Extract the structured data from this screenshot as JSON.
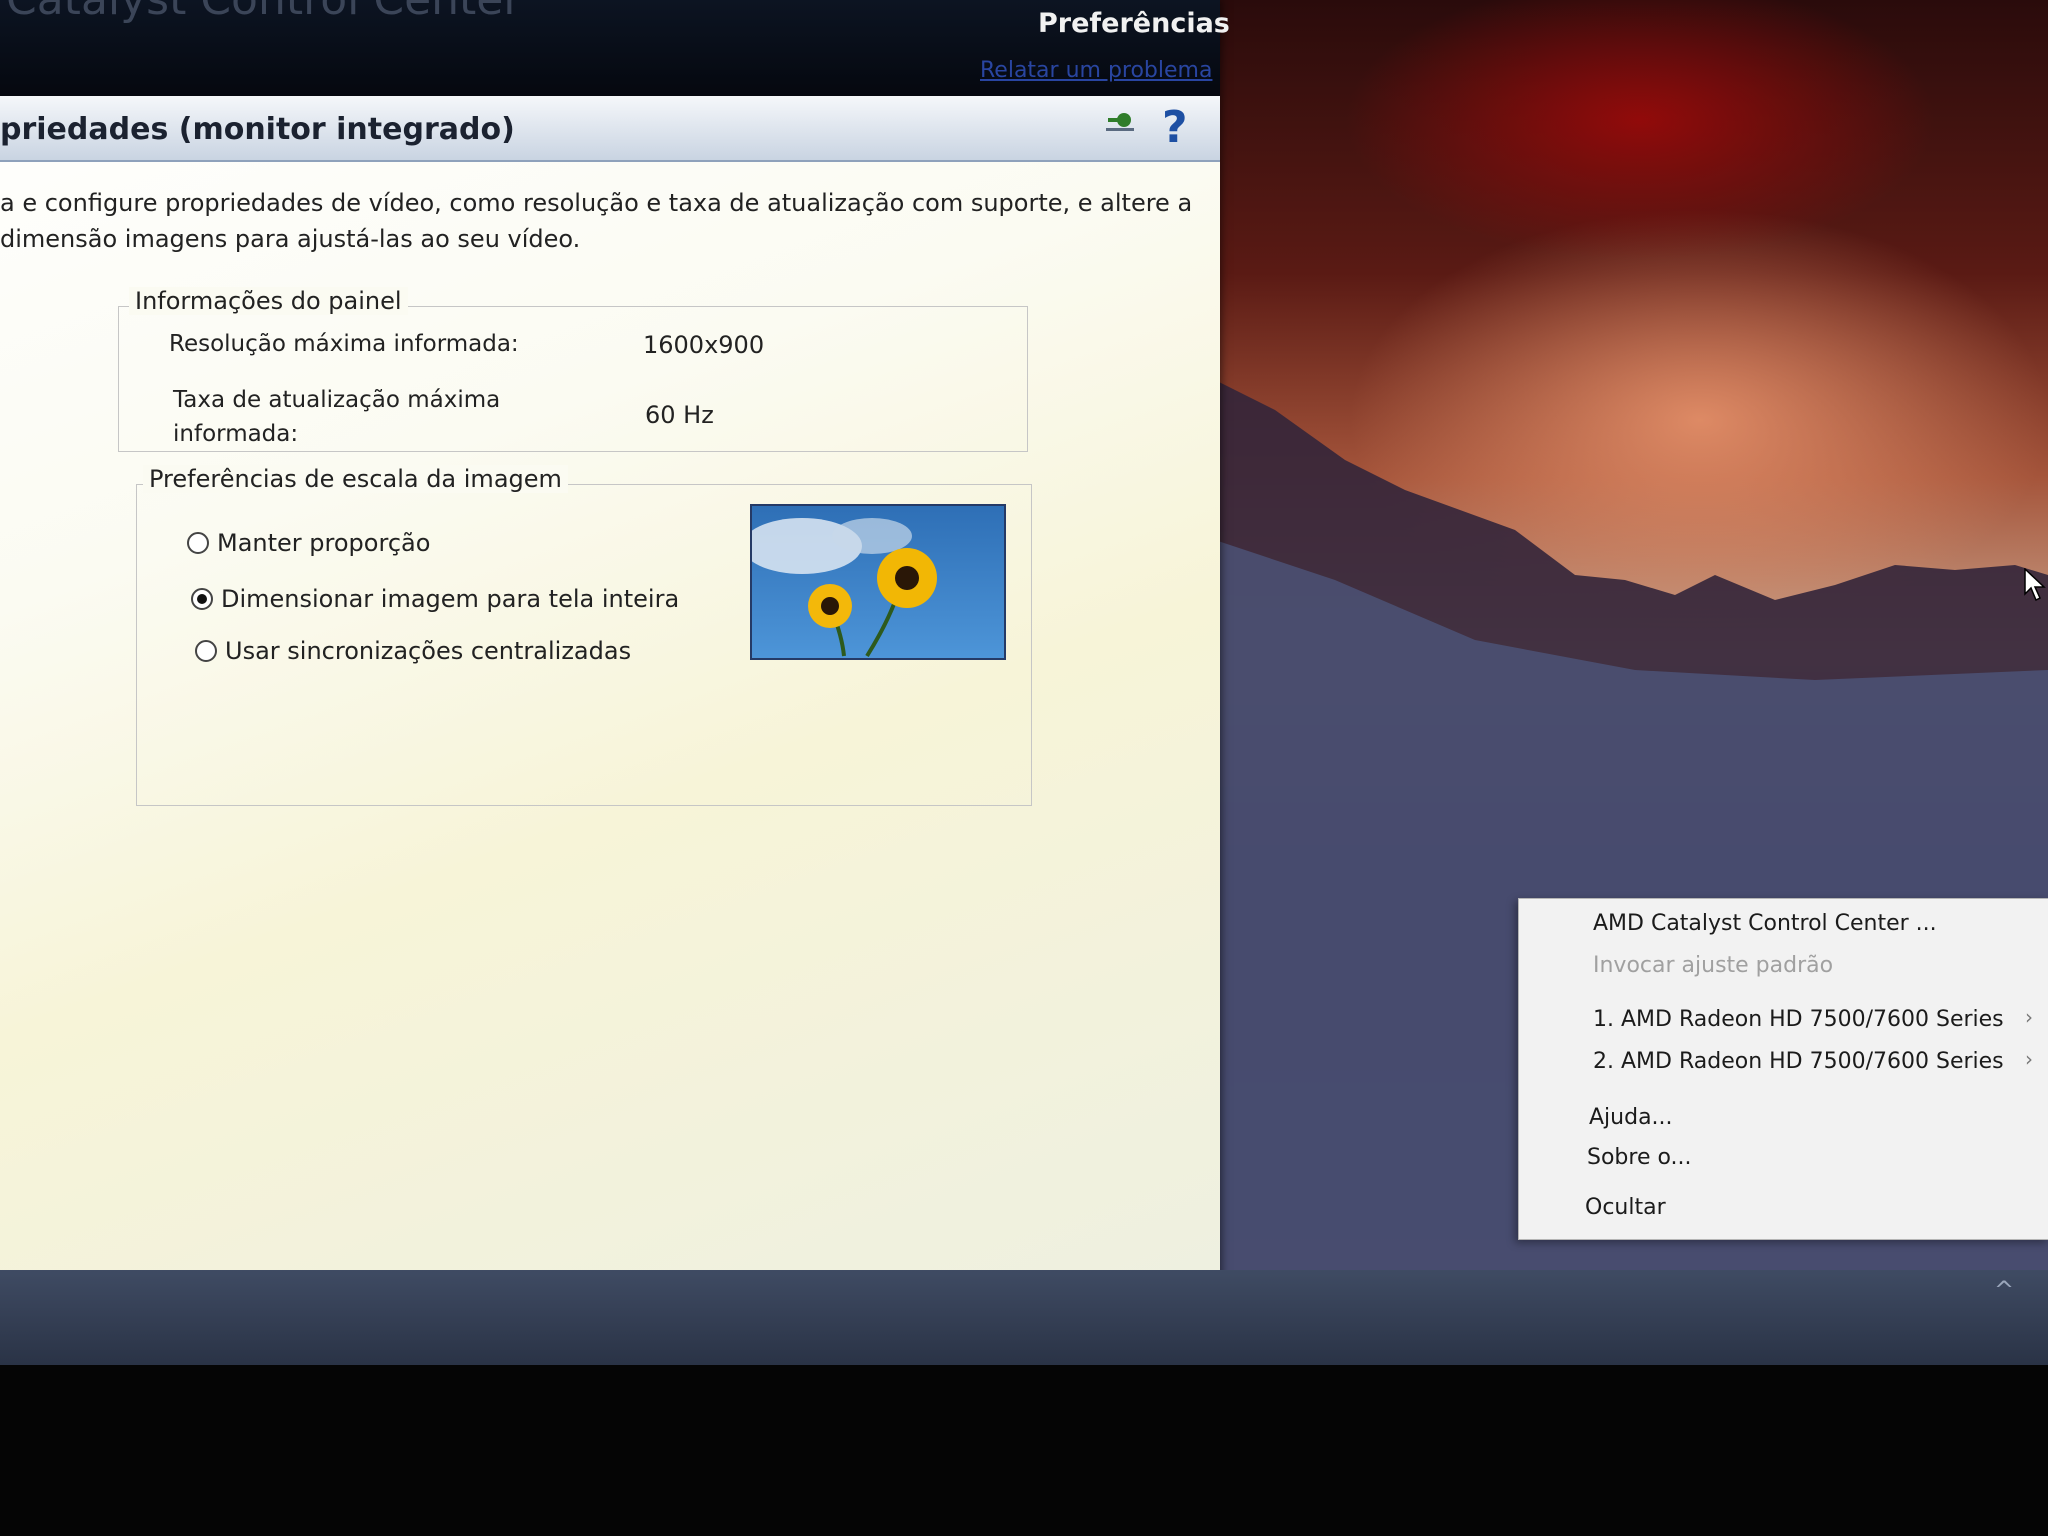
{
  "window": {
    "app_title": "Catalyst Control Center",
    "preferences_menu": "Preferências",
    "report_problem_link": "Relatar um problema"
  },
  "page": {
    "title": "priedades (monitor integrado)",
    "description": "a e configure propriedades de vídeo, como resolução e taxa de atualização com suporte, e altere a dimensão imagens para ajustá-las ao seu vídeo."
  },
  "panel_info": {
    "legend": "Informações do painel",
    "max_resolution_label": "Resolução máxima informada:",
    "max_resolution_value": "1600x900",
    "max_refresh_label": "Taxa de atualização máxima informada:",
    "max_refresh_value": "60 Hz"
  },
  "scaling": {
    "legend": "Preferências de escala da imagem",
    "options": [
      {
        "label": "Manter proporção",
        "selected": false
      },
      {
        "label": "Dimensionar imagem para tela inteira",
        "selected": true
      },
      {
        "label": "Usar sincronizações centralizadas",
        "selected": false
      }
    ]
  },
  "context_menu": {
    "items": [
      {
        "label": "AMD Catalyst Control Center ...",
        "enabled": true
      },
      {
        "label": "Invocar ajuste padrão",
        "enabled": false
      },
      {
        "label": "1. AMD Radeon HD 7500/7600 Series",
        "enabled": true,
        "submenu": true
      },
      {
        "label": "2. AMD Radeon HD 7500/7600 Series",
        "enabled": true,
        "submenu": true
      },
      {
        "label": "Ajuda...",
        "enabled": true
      },
      {
        "label": "Sobre o...",
        "enabled": true
      },
      {
        "label": "Ocultar",
        "enabled": true
      }
    ],
    "submenu_arrow": "›"
  },
  "icons": {
    "help": "?",
    "pin": "pin-icon",
    "tray_chevron": "^"
  },
  "colors": {
    "titlebar": "#05080f",
    "help_accent": "#1d4fa3",
    "link": "#2945a0"
  }
}
